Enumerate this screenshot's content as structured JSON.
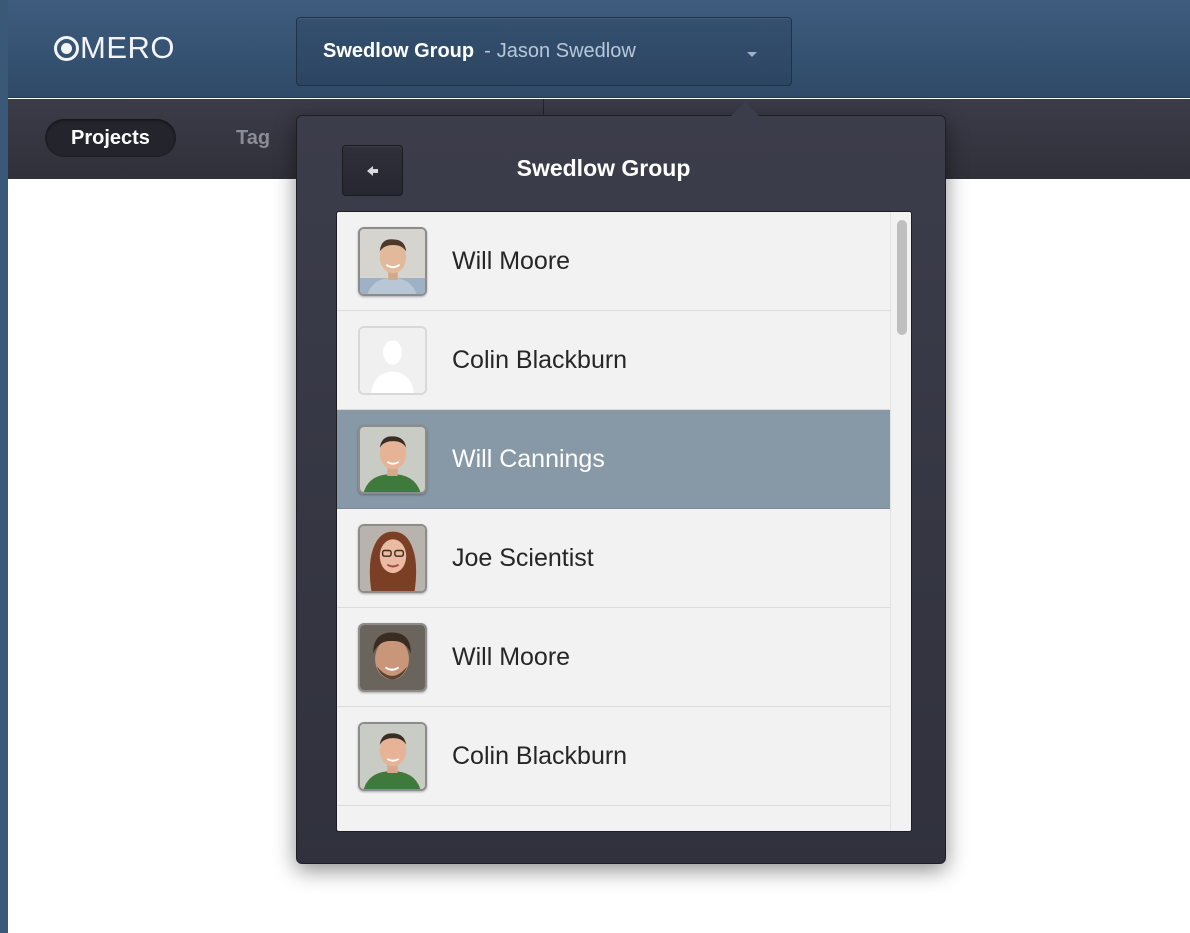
{
  "app": {
    "logo_text": "MERO"
  },
  "group_selector": {
    "group_name": "Swedlow Group",
    "separator": "-",
    "user_name": "Jason Swedlow"
  },
  "tabs": [
    {
      "label": "Projects",
      "active": true
    },
    {
      "label": "Tag",
      "active": false
    }
  ],
  "popover": {
    "title": "Swedlow Group",
    "members": [
      {
        "name": "Will Moore",
        "avatar": "photo-man-smiling-blue-shirt",
        "selected": false
      },
      {
        "name": "Colin Blackburn",
        "avatar": "default-user-silhouette",
        "selected": false
      },
      {
        "name": "Will Cannings",
        "avatar": "photo-man-green-shirt",
        "selected": true
      },
      {
        "name": "Joe Scientist",
        "avatar": "photo-woman-glasses",
        "selected": false
      },
      {
        "name": "Will Moore",
        "avatar": "photo-man-beard",
        "selected": false
      },
      {
        "name": "Colin Blackburn",
        "avatar": "photo-man-green-shirt",
        "selected": false
      }
    ]
  },
  "colors": {
    "header_blue": "#34506f",
    "subnav_dark": "#33343e",
    "selected_row": "#8798a6"
  }
}
